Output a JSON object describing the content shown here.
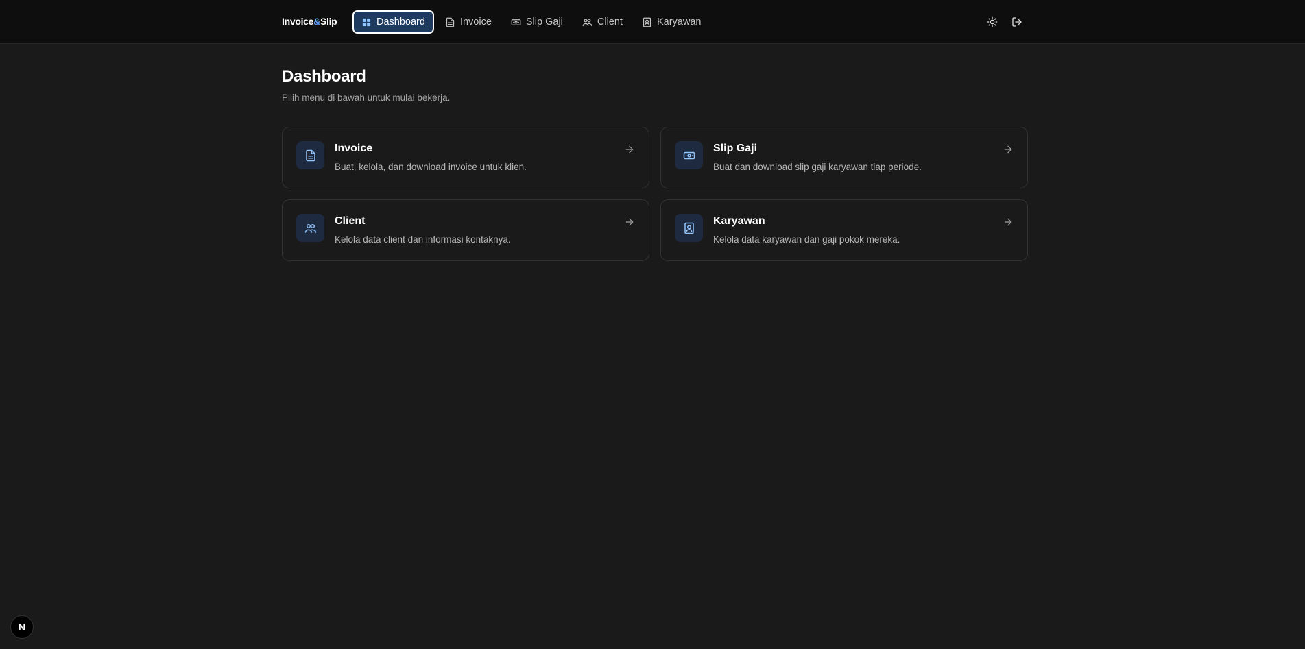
{
  "brand": {
    "name_part1": "Invoice",
    "name_amp": "&",
    "name_part2": "Slip"
  },
  "nav": [
    {
      "label": "Dashboard",
      "icon": "grid-icon",
      "active": true
    },
    {
      "label": "Invoice",
      "icon": "file-text-icon",
      "active": false
    },
    {
      "label": "Slip Gaji",
      "icon": "banknote-icon",
      "active": false
    },
    {
      "label": "Client",
      "icon": "users-icon",
      "active": false
    },
    {
      "label": "Karyawan",
      "icon": "contact-icon",
      "active": false
    }
  ],
  "header_actions": [
    {
      "icon": "sun-icon"
    },
    {
      "icon": "logout-icon"
    }
  ],
  "page": {
    "title": "Dashboard",
    "subtitle": "Pilih menu di bawah untuk mulai bekerja."
  },
  "cards": [
    {
      "title": "Invoice",
      "description": "Buat, kelola, dan download invoice untuk klien.",
      "icon": "file-text-icon"
    },
    {
      "title": "Slip Gaji",
      "description": "Buat dan download slip gaji karyawan tiap periode.",
      "icon": "banknote-icon"
    },
    {
      "title": "Client",
      "description": "Kelola data client dan informasi kontaknya.",
      "icon": "users-icon"
    },
    {
      "title": "Karyawan",
      "description": "Kelola data karyawan dan gaji pokok mereka.",
      "icon": "contact-icon"
    }
  ],
  "dev_badge": {
    "label": "N"
  },
  "colors": {
    "accent": "#60a5fa",
    "active_bg": "#1e3a5f",
    "background": "#1a1a1a",
    "topbar": "#0e0e0e"
  }
}
